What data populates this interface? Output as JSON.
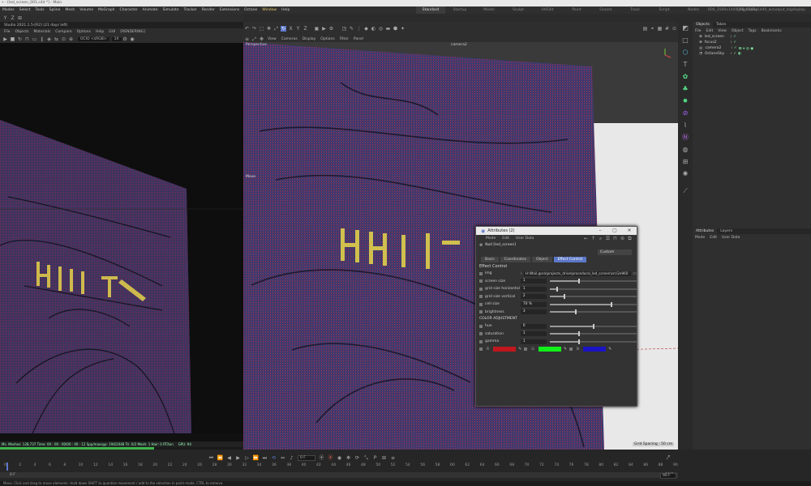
{
  "titlebar": {
    "text": "• - [led_screen_001.c4d *] - Main"
  },
  "menubar": {
    "items": [
      "Modes",
      "Select",
      "Tools",
      "Spline",
      "Mesh",
      "Volume",
      "MoGraph",
      "Character",
      "Animate",
      "Simulate",
      "Tracker",
      "Render",
      "Extensions",
      "Octane",
      "Window",
      "Help"
    ],
    "layouts": [
      "Standard",
      "Startup",
      "Model",
      "Sculpt",
      "UVEdit",
      "Paint",
      "Groom",
      "Track",
      "Script",
      "Nodes",
      "606_2560x1440_bigdisplay",
      "606_2560x1440_w/output_bigdisplay"
    ],
    "active_layout": "Standard"
  },
  "live_viewer": {
    "title": "Studio 2021.1.5-[R2] (21 days left)",
    "menu": [
      "File",
      "Objects",
      "Materials",
      "Compare",
      "Options",
      "Help",
      "GUI",
      "[RENDERING]"
    ],
    "device": "OCIO <sRGB>",
    "zoom": "1X",
    "status": "Ms. Meshes: 128,737   Time: 00 : 00 : 00/00 : 00 : 12   Spp/maxspp: 194/2048   Tri: 0/2   Mesh: 1   Hair: 0   RTXon",
    "gpu": "GPU: 94"
  },
  "viewport": {
    "menu": [
      "View",
      "Cameras",
      "Display",
      "Options",
      "Filter",
      "Panel"
    ],
    "label_left": "Perspective",
    "label_right": "camera2",
    "move_label": "Move",
    "grid_spacing": "Grid Spacing : 50 cm"
  },
  "object_manager": {
    "tabs": [
      "Objects",
      "Takes"
    ],
    "menu": [
      "File",
      "Edit",
      "View",
      "Object",
      "Tags",
      "Bookmarks"
    ],
    "items": [
      {
        "name": "led_screen"
      },
      {
        "name": "focus2"
      },
      {
        "name": "camera2"
      },
      {
        "name": "OctaneSky"
      }
    ]
  },
  "attribute_manager": {
    "tabs": [
      "Attributes",
      "Layers"
    ],
    "menu": [
      "Mode",
      "Edit",
      "User Data"
    ]
  },
  "attr_window": {
    "title": "Attributes (2)",
    "menu": [
      "Mode",
      "Edit",
      "User Data"
    ],
    "object_line": "Null [led_screen]",
    "dropdown": "Custom",
    "tabs": [
      "Basic",
      "Coordinates",
      "Object",
      "Effect Control"
    ],
    "active_tab": "Effect Control",
    "section": "Effect Control",
    "img_label": "img",
    "img_path": "H:\\Mail.gora\\projects_drive\\procedural_led_screen\\src\\2e960",
    "params": [
      {
        "label": "screen size",
        "value": "1",
        "fill": 0.33
      },
      {
        "label": "grid size horizontal",
        "value": "1",
        "fill": 0.08
      },
      {
        "label": "grid size vertical",
        "value": "2",
        "fill": 0.16
      },
      {
        "label": "cell size",
        "value": "70 %",
        "fill": 0.7
      },
      {
        "label": "brightness",
        "value": "3",
        "fill": 0.29
      }
    ],
    "color_section": "COLOR ADJUSTMENT",
    "color_params": [
      {
        "label": "hue",
        "value": "0",
        "fill": 0.5
      },
      {
        "label": "saturation",
        "value": "1",
        "fill": 0.33
      },
      {
        "label": "gamma",
        "value": "1",
        "fill": 0.33
      }
    ],
    "colors": {
      "red": "#c0171d",
      "green": "#12f01a",
      "blue": "#1b14c4"
    },
    "color_labels": [
      "R",
      "G",
      "B"
    ]
  },
  "timeline": {
    "current_frame": "0 F",
    "start_frame": "0 F",
    "end_frame": "90 F",
    "range_end": "90 F",
    "ticks": [
      "0",
      "2",
      "4",
      "6",
      "8",
      "10",
      "12",
      "14",
      "16",
      "18",
      "20",
      "22",
      "24",
      "26",
      "28",
      "30",
      "32",
      "34",
      "36",
      "38",
      "40",
      "42",
      "44",
      "46",
      "48",
      "50",
      "52",
      "54",
      "56",
      "58",
      "60",
      "62",
      "64",
      "66",
      "68",
      "70",
      "72",
      "74",
      "76",
      "78",
      "80",
      "82",
      "84",
      "86",
      "88",
      "90"
    ],
    "end_field": "90 F"
  },
  "status": {
    "text": "Move: Click and drag to move elements. Hold down SHIFT to quantize movement / add to the selection in point mode, CTRL to remove."
  },
  "colors": {
    "accent": "#5c78c9",
    "active_menu": "#e4c766"
  }
}
